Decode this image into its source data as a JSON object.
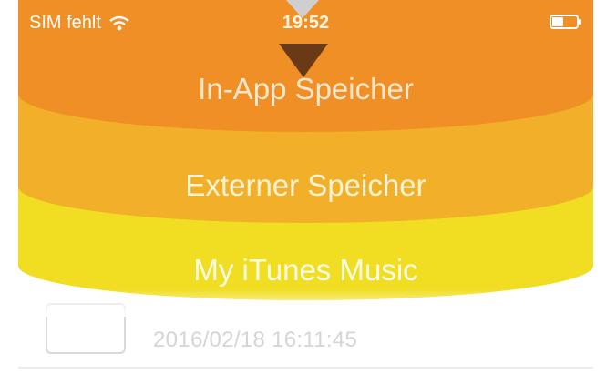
{
  "status_bar": {
    "carrier": "SIM fehlt",
    "time": "19:52",
    "wifi_icon": "wifi-icon",
    "battery_icon": "battery-icon"
  },
  "menu": {
    "items": [
      {
        "label": "In-App Speicher",
        "color": "#f08f25"
      },
      {
        "label": "Externer Speicher",
        "color": "#f2b02a"
      },
      {
        "label": "My iTunes Music",
        "color": "#f1dd22"
      }
    ]
  },
  "list": {
    "rows": [
      {
        "date": "2016/02/18 16:11:45"
      }
    ]
  },
  "indicator": {
    "icon": "pull-down-arrow-icon"
  }
}
